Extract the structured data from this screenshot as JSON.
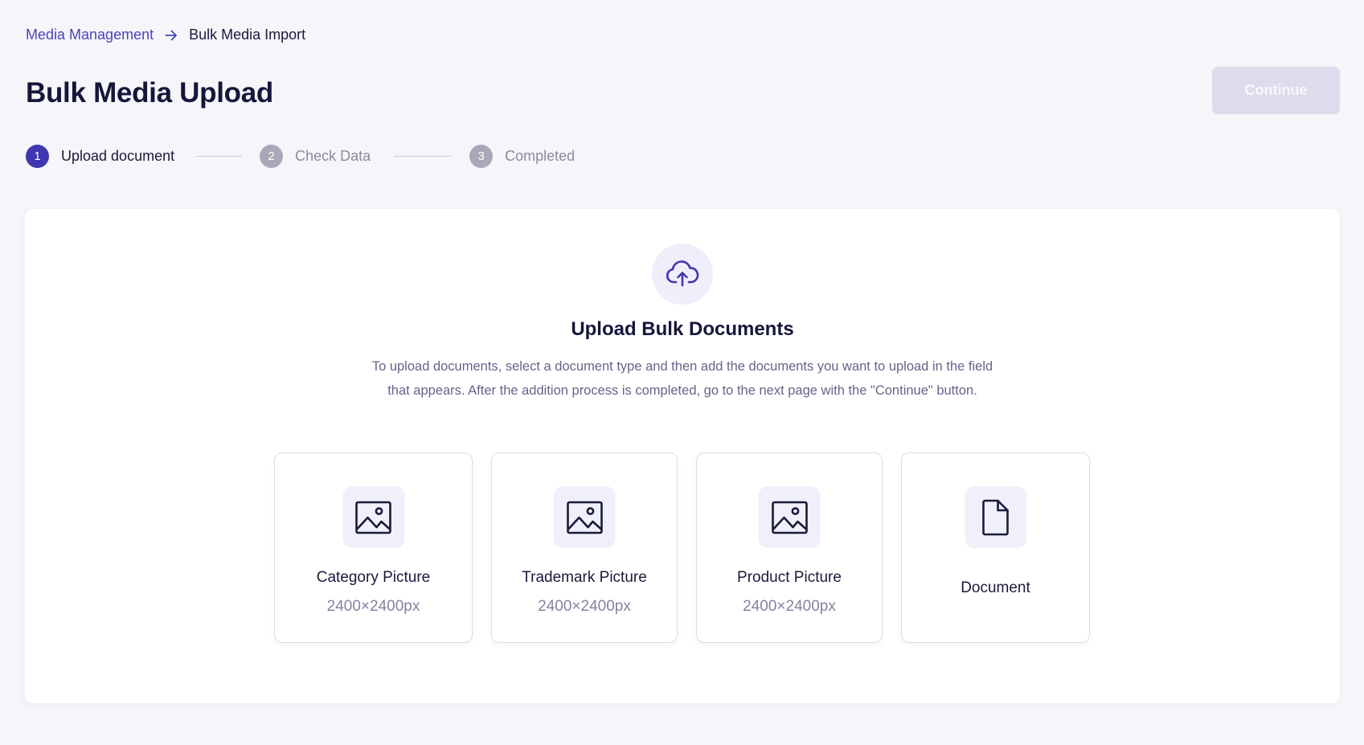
{
  "breadcrumb": {
    "parent": "Media Management",
    "current": "Bulk Media Import"
  },
  "header": {
    "title": "Bulk Media Upload",
    "continue_label": "Continue"
  },
  "stepper": {
    "steps": [
      {
        "number": "1",
        "label": "Upload document",
        "state": "active"
      },
      {
        "number": "2",
        "label": "Check Data",
        "state": "pending"
      },
      {
        "number": "3",
        "label": "Completed",
        "state": "pending"
      }
    ]
  },
  "upload": {
    "icon": "cloud-upload-icon",
    "title": "Upload Bulk Documents",
    "description": "To upload documents, select a document type and then add the documents you want to upload in the field that appears. After the addition process is completed, go to the next page with the \"Continue\" button."
  },
  "document_types": [
    {
      "icon": "image-icon",
      "name": "Category Picture",
      "size": "2400×2400px"
    },
    {
      "icon": "image-icon",
      "name": "Trademark Picture",
      "size": "2400×2400px"
    },
    {
      "icon": "image-icon",
      "name": "Product Picture",
      "size": "2400×2400px"
    },
    {
      "icon": "file-icon",
      "name": "Document"
    }
  ],
  "colors": {
    "accent": "#3f36b0",
    "link": "#4b44b8",
    "button_disabled": "#dddcec",
    "background": "#f5f5fa"
  }
}
